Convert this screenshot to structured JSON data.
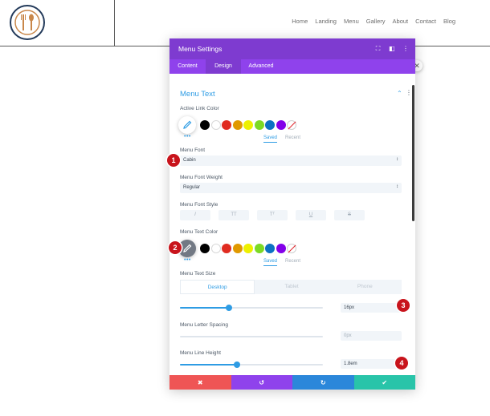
{
  "site": {
    "nav": [
      "Home",
      "Landing",
      "Menu",
      "Gallery",
      "About",
      "Contact",
      "Blog"
    ]
  },
  "modal": {
    "title": "Menu Settings",
    "tabs": [
      {
        "label": "Content",
        "active": false
      },
      {
        "label": "Design",
        "active": true
      },
      {
        "label": "Advanced",
        "active": false
      }
    ],
    "section_title": "Menu Text",
    "active_link_color": {
      "label": "Active Link Color",
      "dots": "•••",
      "saved": "Saved",
      "recent": "Recent"
    },
    "menu_font": {
      "label": "Menu Font",
      "value": "Cabin",
      "arrows": "↕"
    },
    "menu_font_weight": {
      "label": "Menu Font Weight",
      "value": "Regular",
      "arrows": "↕"
    },
    "menu_font_style": {
      "label": "Menu Font Style",
      "buttons": [
        "I",
        "TT",
        "Tᵀ",
        "U",
        "S"
      ]
    },
    "menu_text_color": {
      "label": "Menu Text Color",
      "dots": "•••",
      "saved": "Saved",
      "recent": "Recent"
    },
    "menu_text_size": {
      "label": "Menu Text Size",
      "devices": [
        "Desktop",
        "Tablet",
        "Phone"
      ],
      "value": "16px",
      "slider_fraction": 0.34
    },
    "menu_letter_spacing": {
      "label": "Menu Letter Spacing",
      "value": "0px",
      "slider_fraction": 0.0
    },
    "menu_line_height": {
      "label": "Menu Line Height",
      "value": "1.8em",
      "slider_fraction": 0.4
    },
    "footer": {
      "cancel": "✖",
      "undo": "↺",
      "redo": "↻",
      "save": "✔"
    }
  },
  "palette": [
    "#000000",
    "#ffffff",
    "#e02b20",
    "#e09900",
    "#edf000",
    "#7cda24",
    "#0c71c3",
    "#8300e9"
  ],
  "colors": {
    "header_purple": "#7e3bd0",
    "tabs_purple": "#8f42ec",
    "accent_blue": "#2e9ce4",
    "cancel_red": "#ef5555",
    "undo_purple": "#8f42ec",
    "redo_blue": "#2b87da",
    "save_green": "#29c4a9",
    "marker_red": "#c8141c"
  },
  "markers": [
    "1",
    "2",
    "3",
    "4"
  ],
  "icons": {
    "logo": "fork-spoon-icon",
    "eyedropper": "eyedropper-icon",
    "fullscreen": "expand-icon",
    "split": "split-view-icon",
    "more": "more-vertical-icon",
    "close": "close-icon"
  }
}
